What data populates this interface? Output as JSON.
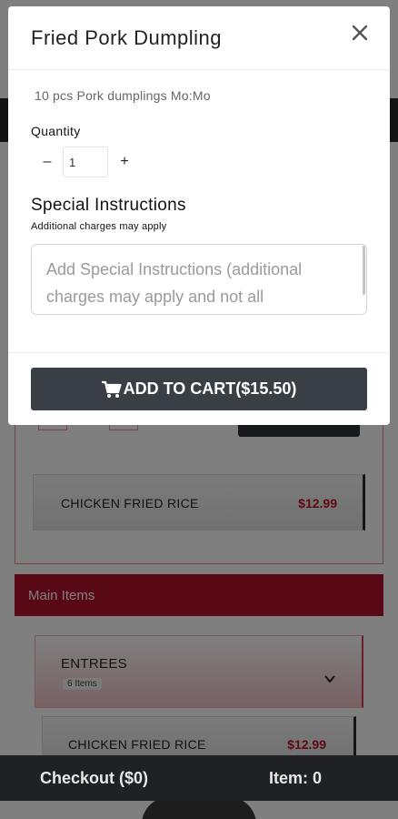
{
  "modal": {
    "title": "Fried Pork Dumpling",
    "close_icon": "close-icon",
    "description": "10 pcs Pork dumplings Mo:Mo",
    "quantity_label": "Quantity",
    "quantity_value": "1",
    "minus_label": "–",
    "plus_label": "+",
    "special_instructions_title": "Special Instructions",
    "special_instructions_subtitle": "Additional charges may apply",
    "special_instructions_placeholder": "Add Special Instructions (additional charges may apply and not all",
    "cart_icon": "cart-icon",
    "add_to_cart_label": "ADD TO CART($15.50)"
  },
  "background": {
    "items": [
      {
        "name": "CHICKEN FRIED RICE",
        "price": "$12.99"
      },
      {
        "name": "CHICKEN FRIED RICE",
        "price": "$12.99"
      }
    ],
    "section_title": "Main Items",
    "category": {
      "title": "ENTREES",
      "count": "6 Items",
      "icon": "chevron-down-icon"
    }
  },
  "checkout_bar": {
    "checkout_label": "Checkout ($0)",
    "items_label": "Item: 0"
  },
  "colors": {
    "accent_red": "#b3122a",
    "price_red": "#c2102b",
    "button_dark": "#3a3e45"
  }
}
